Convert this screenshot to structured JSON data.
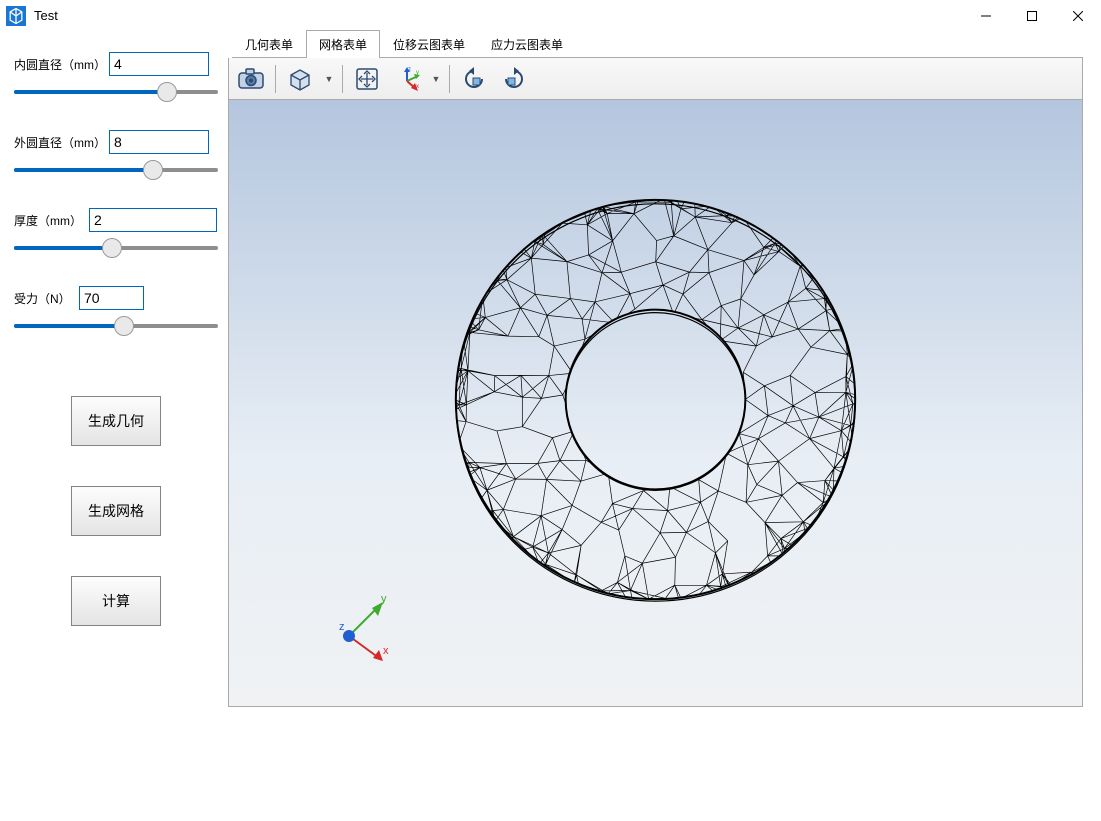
{
  "window": {
    "title": "Test"
  },
  "params": {
    "inner_dia_label": "内圆直径（mm）",
    "inner_dia_value": "4",
    "inner_dia_pct": 75,
    "outer_dia_label": "外圆直径（mm）",
    "outer_dia_value": "8",
    "outer_dia_pct": 68,
    "thickness_label": "厚度（mm）",
    "thickness_value": "2",
    "thickness_pct": 48,
    "force_label": "受力（N）",
    "force_value": "70",
    "force_pct": 54
  },
  "buttons": {
    "gen_geom": "生成几何",
    "gen_mesh": "生成网格",
    "compute": "计算"
  },
  "tabs": {
    "geometry": "几何表单",
    "mesh": "网格表单",
    "displacement": "位移云图表单",
    "stress": "应力云图表单",
    "active": "mesh"
  },
  "toolbar_icons": {
    "snapshot": "camera-icon",
    "view_mode": "cube-icon",
    "zoom_fit": "fit-icon",
    "axes": "axes-icon",
    "rotate_left": "rotate-left-icon",
    "rotate_right": "rotate-right-icon"
  },
  "axes": {
    "x": "x",
    "y": "y",
    "z": "z"
  },
  "colors": {
    "accent": "#0067c0",
    "x_axis": "#d62828",
    "y_axis": "#3eaa2f",
    "z_axis": "#1f5fd0"
  }
}
